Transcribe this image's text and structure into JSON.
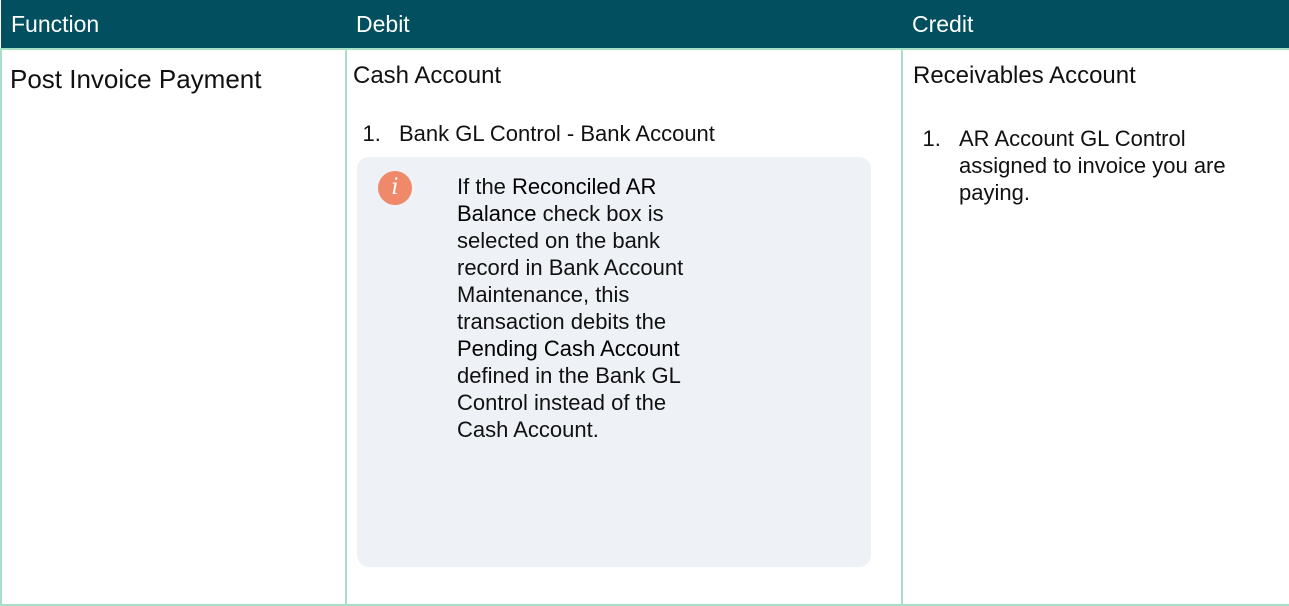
{
  "table": {
    "headers": [
      "Function",
      "Debit",
      "Credit"
    ],
    "row": {
      "function": "Post Invoice Payment",
      "debit_account": "Cash Account",
      "debit_items": [
        "Bank GL Control - Bank Account"
      ],
      "note": {
        "icon": "info-icon",
        "text_1": " If the ",
        "bold_1": "Reconciled AR Balance",
        "text_2": " check box is selected on the bank record in Bank Account Maintenance, this transaction debits the ",
        "bold_2": "Pending Cash Account",
        "text_3": " defined in the Bank GL Control instead of the Cash Account."
      },
      "credit_account": "Receivables Account",
      "credit_items": [
        "AR Account GL Control assigned to invoice you are paying."
      ]
    }
  },
  "colors": {
    "header_bg": "#02505f",
    "border": "#a6e0c8",
    "note_bg": "#eef1f5",
    "icon_bg": "#f0896a"
  }
}
